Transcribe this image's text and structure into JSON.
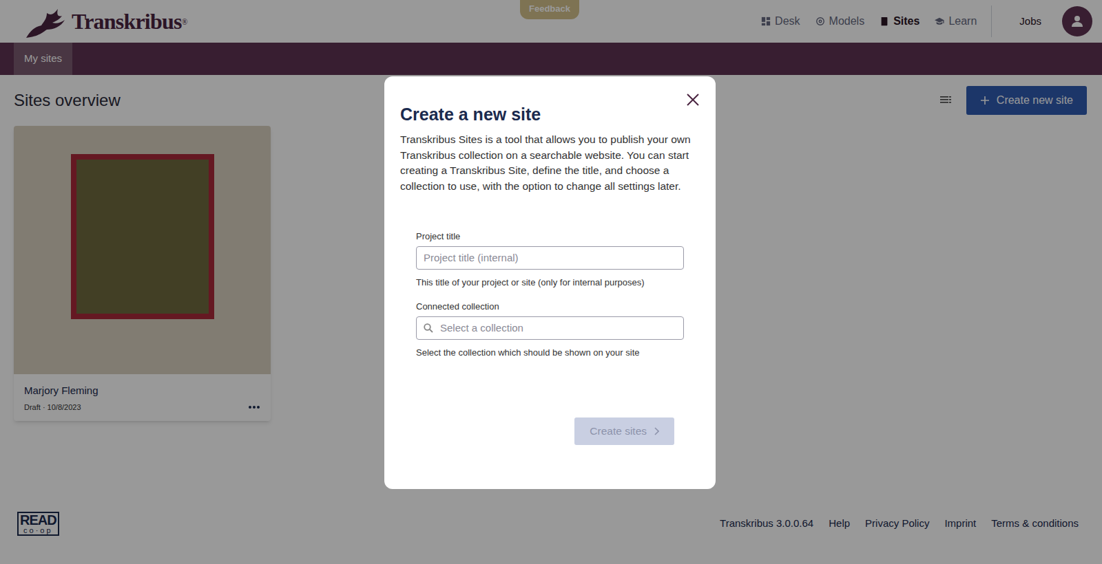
{
  "header": {
    "logo": "Transkribus",
    "logo_mark": "®",
    "feedback": "Feedback",
    "nav": [
      {
        "label": "Desk",
        "selected": false
      },
      {
        "label": "Models",
        "selected": false
      },
      {
        "label": "Sites",
        "selected": true
      },
      {
        "label": "Learn",
        "selected": false
      }
    ],
    "jobs": "Jobs"
  },
  "subnav": [
    {
      "label": "My sites",
      "selected": true
    }
  ],
  "page": {
    "title": "Sites overview",
    "create_button": "Create new site"
  },
  "sites": [
    {
      "title": "Marjory Fleming",
      "meta": "Draft · 10/8/2023"
    }
  ],
  "modal": {
    "title": "Create a new site",
    "description": "Transkribus Sites is a tool that allows you to publish your own Transkribus collection on a searchable website. You can start creating a Transkribus Site, define the title, and choose a collection to use, with the option to change all settings later.",
    "fields": [
      {
        "kind": "text",
        "label": "Project title",
        "placeholder": "Project title (internal)",
        "help": "This title of your project or site (only for internal purposes)"
      },
      {
        "kind": "search",
        "label": "Connected collection",
        "placeholder": "Select a collection",
        "help": "Select the collection which should be shown on your site"
      }
    ],
    "submit": {
      "label": "Create sites",
      "disabled": true
    }
  },
  "footer": {
    "logo_top": "READ",
    "logo_bottom": "co·op",
    "version": "Transkribus 3.0.0.64",
    "links": [
      "Help",
      "Privacy Policy",
      "Imprint",
      "Terms & conditions"
    ]
  }
}
